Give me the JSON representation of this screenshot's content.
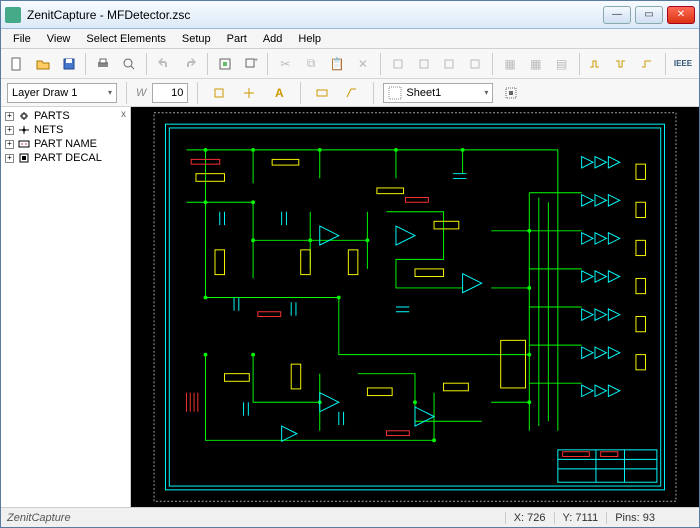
{
  "window": {
    "title": "ZenitCapture - MFDetector.zsc"
  },
  "menu": {
    "file": "File",
    "view": "View",
    "select_elements": "Select Elements",
    "setup": "Setup",
    "part": "Part",
    "add": "Add",
    "help": "Help"
  },
  "toolbar2": {
    "layer_label": "Layer Draw 1",
    "width_label": "W",
    "width_value": "10",
    "sheet_label": "Sheet1"
  },
  "tree": {
    "items": [
      {
        "label": "PARTS"
      },
      {
        "label": "NETS"
      },
      {
        "label": "PART NAME"
      },
      {
        "label": "PART DECAL"
      }
    ]
  },
  "status": {
    "app": "ZenitCapture",
    "x_label": "X:",
    "x_value": "726",
    "y_label": "Y:",
    "y_value": "7111",
    "pins_label": "Pins:",
    "pins_value": "93"
  },
  "icons": {
    "minimize": "—",
    "maximize": "▭",
    "close": "✕",
    "dropdown": "▾",
    "tree_close": "x",
    "expand": "+",
    "ieee": "IEEE"
  }
}
